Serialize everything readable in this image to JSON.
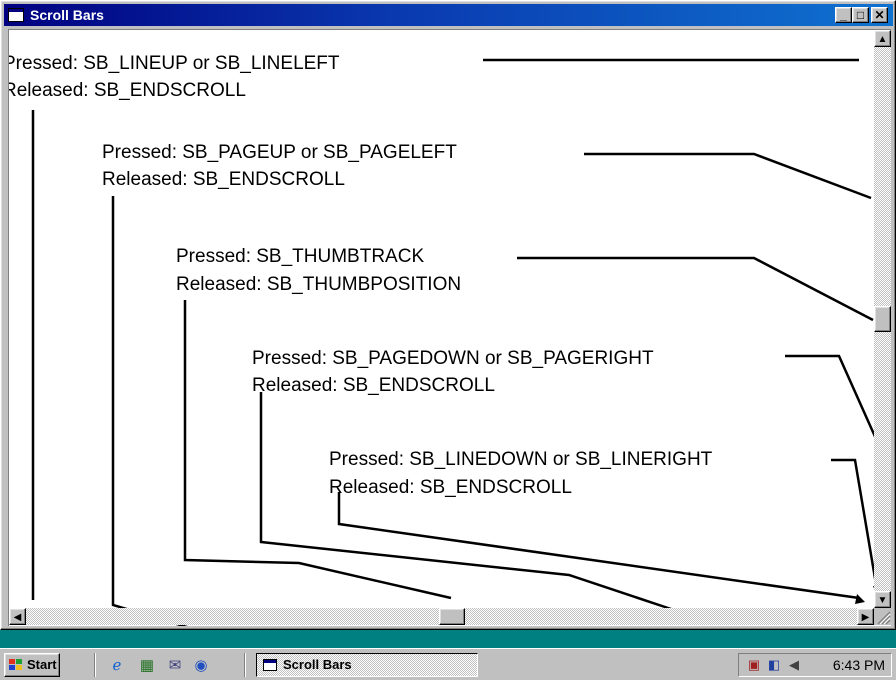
{
  "window": {
    "title": "Scroll Bars",
    "minimize_glyph": "_",
    "maximize_glyph": "□",
    "close_glyph": "✕"
  },
  "labels": [
    {
      "pressed": "Pressed: SB_LINEUP or SB_LINELEFT",
      "released": "Released: SB_ENDSCROLL"
    },
    {
      "pressed": "Pressed: SB_PAGEUP or SB_PAGELEFT",
      "released": "Released: SB_ENDSCROLL"
    },
    {
      "pressed": "Pressed: SB_THUMBTRACK",
      "released": "Released: SB_THUMBPOSITION"
    },
    {
      "pressed": "Pressed: SB_PAGEDOWN or SB_PAGERIGHT",
      "released": "Released: SB_ENDSCROLL"
    },
    {
      "pressed": "Pressed: SB_LINEDOWN or SB_LINERIGHT",
      "released": "Released: SB_ENDSCROLL"
    }
  ],
  "scrollbars": {
    "up_arrow": "▲",
    "down_arrow": "▼",
    "left_arrow": "◀",
    "right_arrow": "▶"
  },
  "taskbar": {
    "start_label": "Start",
    "quick_launch": [
      "ie-icon",
      "desktop-icon",
      "outlook-icon",
      "channels-icon"
    ],
    "task_button_label": "Scroll Bars",
    "clock": "6:43 PM",
    "tray_icons": [
      "scheduler-icon",
      "network-icon",
      "volume-icon"
    ]
  },
  "colors": {
    "desktop": "#008080",
    "titlebar_start": "#000080",
    "titlebar_end": "#0f72d0",
    "face": "#c0c0c0"
  }
}
